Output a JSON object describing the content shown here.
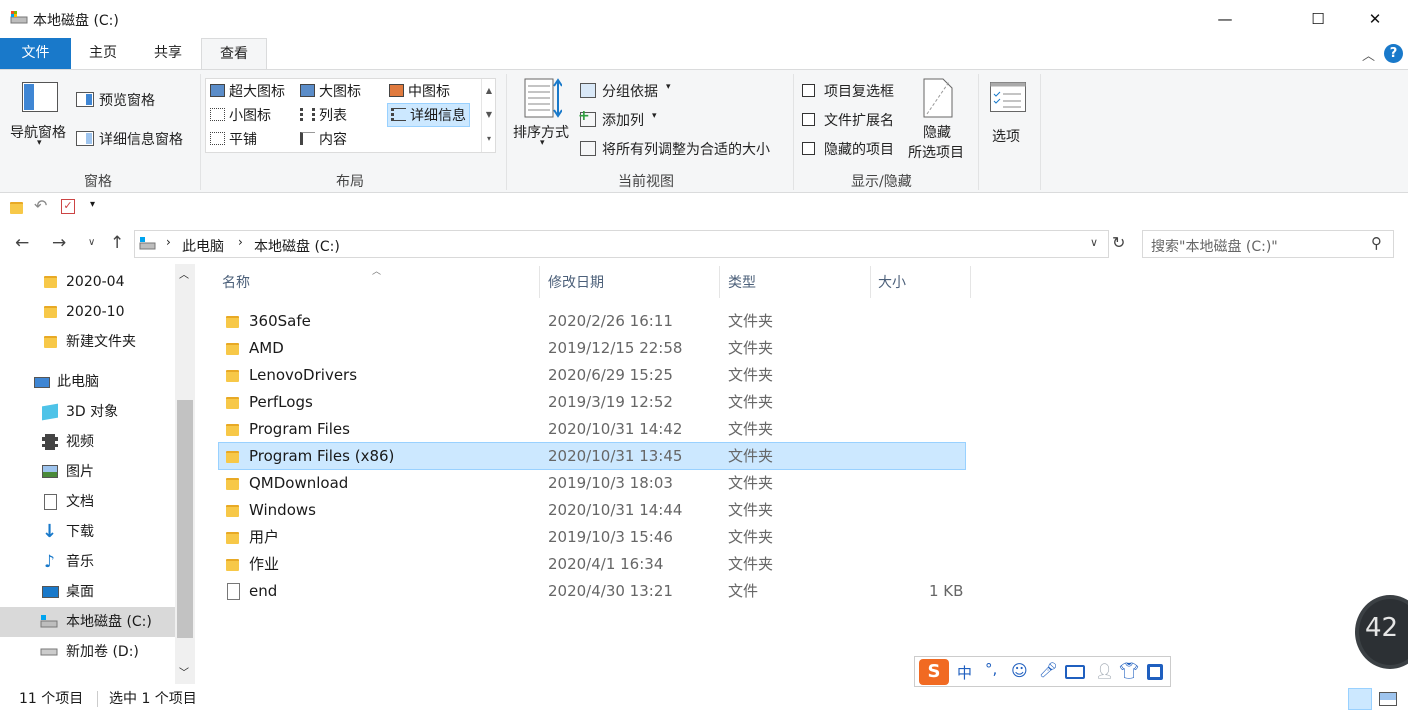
{
  "window": {
    "title": "本地磁盘 (C:)",
    "controls": {
      "minimize": "—",
      "maximize": "☐",
      "close": "✕"
    }
  },
  "tabs": [
    {
      "label": "文件"
    },
    {
      "label": "主页"
    },
    {
      "label": "共享"
    },
    {
      "label": "查看"
    }
  ],
  "ribbon": {
    "panes": {
      "nav_pane": "导航窗格",
      "preview_pane": "预览窗格",
      "details_pane": "详细信息窗格",
      "group_label": "窗格"
    },
    "layout": {
      "items": [
        "超大图标",
        "大图标",
        "中图标",
        "小图标",
        "列表",
        "详细信息",
        "平铺",
        "内容"
      ],
      "selected": "详细信息",
      "group_label": "布局"
    },
    "current_view": {
      "sort_by": "排序方式",
      "group_by": "分组依据",
      "add_columns": "添加列",
      "size_all_columns": "将所有列调整为合适的大小",
      "group_label": "当前视图"
    },
    "show_hide": {
      "item_checkboxes": "项目复选框",
      "file_extensions": "文件扩展名",
      "hidden_items": "隐藏的项目",
      "hide_selected_1": "隐藏",
      "hide_selected_2": "所选项目",
      "group_label": "显示/隐藏"
    },
    "options": "选项"
  },
  "address": {
    "crumbs": [
      "此电脑",
      "本地磁盘 (C:)"
    ],
    "search_placeholder": "搜索\"本地磁盘 (C:)\""
  },
  "nav_pane": {
    "items": [
      {
        "label": "2020-04",
        "icon": "folder-icon"
      },
      {
        "label": "2020-10",
        "icon": "folder-icon"
      },
      {
        "label": "新建文件夹",
        "icon": "folder-icon"
      },
      {
        "label": "此电脑",
        "icon": "computer-icon"
      },
      {
        "label": "3D 对象",
        "icon": "cube-icon"
      },
      {
        "label": "视频",
        "icon": "video-icon"
      },
      {
        "label": "图片",
        "icon": "pictures-icon"
      },
      {
        "label": "文档",
        "icon": "document-icon"
      },
      {
        "label": "下载",
        "icon": "download-icon"
      },
      {
        "label": "音乐",
        "icon": "music-icon"
      },
      {
        "label": "桌面",
        "icon": "desktop-icon"
      },
      {
        "label": "本地磁盘 (C:)",
        "icon": "drive-icon"
      },
      {
        "label": "新加卷 (D:)",
        "icon": "drive-icon"
      }
    ],
    "selected": "本地磁盘 (C:)"
  },
  "columns": [
    "名称",
    "修改日期",
    "类型",
    "大小"
  ],
  "files": [
    {
      "name": "360Safe",
      "date": "2020/2/26 16:11",
      "type": "文件夹",
      "size": ""
    },
    {
      "name": "AMD",
      "date": "2019/12/15 22:58",
      "type": "文件夹",
      "size": ""
    },
    {
      "name": "LenovoDrivers",
      "date": "2020/6/29 15:25",
      "type": "文件夹",
      "size": ""
    },
    {
      "name": "PerfLogs",
      "date": "2019/3/19 12:52",
      "type": "文件夹",
      "size": ""
    },
    {
      "name": "Program Files",
      "date": "2020/10/31 14:42",
      "type": "文件夹",
      "size": ""
    },
    {
      "name": "Program Files (x86)",
      "date": "2020/10/31 13:45",
      "type": "文件夹",
      "size": ""
    },
    {
      "name": "QMDownload",
      "date": "2019/10/3 18:03",
      "type": "文件夹",
      "size": ""
    },
    {
      "name": "Windows",
      "date": "2020/10/31 14:44",
      "type": "文件夹",
      "size": ""
    },
    {
      "name": "用户",
      "date": "2019/10/3 15:46",
      "type": "文件夹",
      "size": ""
    },
    {
      "name": "作业",
      "date": "2020/4/1 16:34",
      "type": "文件夹",
      "size": ""
    },
    {
      "name": "end",
      "date": "2020/4/30 13:21",
      "type": "文件",
      "size": "1 KB"
    }
  ],
  "selected_file": "Program Files (x86)",
  "status": {
    "item_count": "11 个项目",
    "selected_count": "选中 1 个项目"
  },
  "ime": {
    "mode": "中",
    "punct": "°,"
  },
  "gauge": {
    "value": "42"
  },
  "colors": {
    "accent": "#1979ca",
    "selection": "#cce8ff",
    "folder": "#f7c848"
  }
}
